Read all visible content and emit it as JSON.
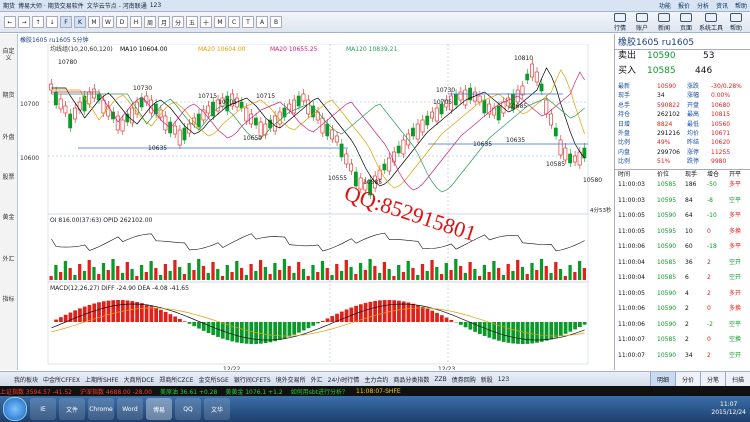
{
  "titlebar": {
    "app": "期货",
    "brand": "博易大师 · 期货交易软件",
    "file": "文华云节点 - 河南联通",
    "num": "123",
    "menus": [
      "功能",
      "报价",
      "分析",
      "资讯",
      "帮助"
    ]
  },
  "toolbar": {
    "buttons": [
      "←",
      "→",
      "↑",
      "↓",
      "F",
      "K",
      "M",
      "W",
      "D",
      "H",
      "周",
      "月",
      "分",
      "五",
      "十",
      "M",
      "C",
      "T",
      "A",
      "B"
    ],
    "menus": [
      {
        "label": "行情",
        "icon": "chart-icon"
      },
      {
        "label": "账户",
        "icon": "account-icon"
      },
      {
        "label": "新闻",
        "icon": "news-icon"
      },
      {
        "label": "页面",
        "icon": "page-icon"
      },
      {
        "label": "系统工具",
        "icon": "tools-icon"
      },
      {
        "label": "帮助",
        "icon": "help-icon"
      }
    ]
  },
  "sidebar": {
    "items": [
      "自定义",
      "期货",
      "外盘",
      "股票",
      "黄金",
      "外汇",
      "指标"
    ]
  },
  "chart_header": {
    "left": "橡胶1605 ru1605 5分钟",
    "ma_label": "均线组(10,20,60,120)",
    "ma10": "MA10 10604.00",
    "ma20": "MA20 10604.00",
    "ma60": "MA20 10655.25",
    "ma120": "MA120 10839.21"
  },
  "chart_data": {
    "type": "candlestick",
    "symbol": "橡胶1605 ru1605",
    "period": "5分钟",
    "price_labels": [
      "10780",
      "10730",
      "10715",
      "10705",
      "10715",
      "10650",
      "10635",
      "10555",
      "10585",
      "10730",
      "10705",
      "10635",
      "10810",
      "10685",
      "10635",
      "10585",
      "10580"
    ],
    "price_axis": [
      "10700",
      "10600"
    ],
    "indicators": {
      "oi": "OI 816.00(37:63)   OPID 262102.00",
      "macd": "MACD(12,26,27)   DIFF -24.90   DEA -4.08   -41.65"
    },
    "dates": [
      "12/22",
      "12/23"
    ],
    "panel_top_label": "4分53秒"
  },
  "watermark": "QQ:852915801",
  "quote": {
    "title": "橡胶1605  ru1605",
    "sell": {
      "label": "卖出",
      "price": "10590",
      "vol": "53"
    },
    "buy": {
      "label": "买入",
      "price": "10585",
      "vol": "446"
    },
    "rows": [
      {
        "l": "最新",
        "v": "10590",
        "r": "涨跌",
        "rv": "-30/0.28%"
      },
      {
        "l": "现手",
        "v": "34",
        "r": "涨幅",
        "rv": "0.00%"
      },
      {
        "l": "总手",
        "v": "590822",
        "r": "开盘",
        "rv": "10680"
      },
      {
        "l": "持仓",
        "v": "262102",
        "r": "最高",
        "rv": "10815"
      },
      {
        "l": "日增",
        "v": "8824",
        "r": "最低",
        "rv": "10560"
      },
      {
        "l": "外盘",
        "v": "291216",
        "r": "均价",
        "rv": "10671"
      },
      {
        "l": "比例",
        "v": "49%",
        "r": "昨结",
        "rv": "10620"
      },
      {
        "l": "内盘",
        "v": "299706",
        "r": "涨停",
        "rv": "11255"
      },
      {
        "l": "比例",
        "v": "51%",
        "r": "跌停",
        "rv": "9980"
      }
    ],
    "ticks_header": [
      "时间",
      "价位",
      "现手",
      "增仓",
      "开平"
    ],
    "ticks": [
      {
        "t": "11:00:03",
        "p": "10585",
        "v": "186",
        "c": "-50",
        "k": "多平"
      },
      {
        "t": "11:00:03",
        "p": "10595",
        "v": "84",
        "c": "-8",
        "k": "空平"
      },
      {
        "t": "11:00:05",
        "p": "10590",
        "v": "64",
        "c": "-10",
        "k": "多平"
      },
      {
        "t": "11:00:05",
        "p": "10595",
        "v": "10",
        "c": "0",
        "k": "多换"
      },
      {
        "t": "11:00:06",
        "p": "10590",
        "v": "60",
        "c": "-18",
        "k": "多平"
      },
      {
        "t": "11:00:04",
        "p": "10585",
        "v": "36",
        "c": "2",
        "k": "空开"
      },
      {
        "t": "11:00:04",
        "p": "10585",
        "v": "6",
        "c": "2",
        "k": "空开"
      },
      {
        "t": "11:00:05",
        "p": "10590",
        "v": "4",
        "c": "2",
        "k": "多开"
      },
      {
        "t": "11:00:06",
        "p": "10590",
        "v": "2",
        "c": "0",
        "k": "多换"
      },
      {
        "t": "11:00:06",
        "p": "10590",
        "v": "2",
        "c": "-2",
        "k": "空平"
      },
      {
        "t": "11:00:07",
        "p": "10585",
        "v": "2",
        "c": "0",
        "k": "空换"
      },
      {
        "t": "11:00:07",
        "p": "10590",
        "v": "34",
        "c": "2",
        "k": "空开"
      }
    ]
  },
  "tabs": {
    "items": [
      "我的板块",
      "中金所CFFEX",
      "上期所SHFE",
      "大商所DCE",
      "郑商所CZCE",
      "金交所SGE",
      "银行间CFETS",
      "境外交易所",
      "外汇",
      "24小时行情",
      "主力合约",
      "商品分类指数",
      "ZZB",
      "债券回购",
      "新股",
      "123"
    ],
    "right": [
      "明细",
      "分价",
      "分笔",
      "扫描"
    ]
  },
  "ticker": [
    {
      "t": "上证指数 3594.57 -41.52",
      "c": "tred"
    },
    {
      "t": "沪深指数 4688.00 -28.00",
      "c": "tred"
    },
    {
      "t": "美原油 36.61 +0.28",
      "c": "tgrn"
    },
    {
      "t": "美黄金 1076.1 +1.2",
      "c": "tgrn"
    },
    {
      "t": "如何用sbt进行分析？",
      "c": "tgrn"
    },
    {
      "t": "11:08:07-SHFE",
      "c": ""
    }
  ],
  "taskbar": {
    "apps": [
      "IE",
      "文件",
      "Chrome",
      "Word",
      "博易",
      "QQ",
      "文华"
    ],
    "time": "11:07",
    "date": "2015/12/24"
  }
}
